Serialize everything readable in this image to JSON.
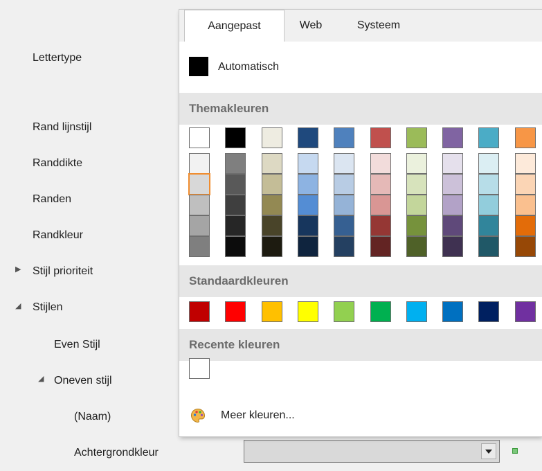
{
  "properties": {
    "font": "Lettertype",
    "border_style": "Rand lijnstijl",
    "border_width": "Randdikte",
    "borders": "Randen",
    "border_color": "Randkleur",
    "style_priority": "Stijl prioriteit",
    "styles": "Stijlen",
    "even_style": "Even Stijl",
    "odd_style": "Oneven stijl",
    "name": "(Naam)",
    "background_color": "Achtergrondkleur"
  },
  "icons": {
    "collapsed": "triangle-right-icon",
    "expanded": "triangle-down-icon",
    "palette": "palette-icon",
    "dropdown": "chevron-down-icon"
  },
  "color_picker": {
    "tabs": [
      {
        "label": "Aangepast",
        "active": true
      },
      {
        "label": "Web",
        "active": false
      },
      {
        "label": "Systeem",
        "active": false
      }
    ],
    "automatic_label": "Automatisch",
    "automatic_color": "#000000",
    "theme_header": "Themakleuren",
    "theme_top": [
      "#FFFFFF",
      "#000000",
      "#EEECE1",
      "#1F497D",
      "#4F81BD",
      "#C0504D",
      "#9BBB59",
      "#8064A2",
      "#4BACC6",
      "#F79646"
    ],
    "theme_shades": [
      [
        "#F2F2F2",
        "#D8D8D8",
        "#BFBFBF",
        "#A5A5A5",
        "#7F7F7F"
      ],
      [
        "#7F7F7F",
        "#595959",
        "#3F3F3F",
        "#262626",
        "#0C0C0C"
      ],
      [
        "#DDD9C3",
        "#C4BD97",
        "#938953",
        "#494429",
        "#1D1B10"
      ],
      [
        "#C6D9F0",
        "#8DB3E2",
        "#548DD4",
        "#17365D",
        "#0F243E"
      ],
      [
        "#DBE5F1",
        "#B8CCE4",
        "#95B3D7",
        "#366092",
        "#244061"
      ],
      [
        "#F2DCDB",
        "#E5B9B7",
        "#D99694",
        "#953734",
        "#632423"
      ],
      [
        "#EBF1DD",
        "#D7E3BC",
        "#C3D69B",
        "#76923C",
        "#4F6128"
      ],
      [
        "#E5E0EC",
        "#CCC1D9",
        "#B2A2C7",
        "#5F497A",
        "#3F3151"
      ],
      [
        "#DBEEF3",
        "#B7DDE8",
        "#92CDDC",
        "#31859B",
        "#205867"
      ],
      [
        "#FDEADA",
        "#FBD5B5",
        "#FAC08F",
        "#E36C09",
        "#974806"
      ]
    ],
    "selected_swatch": "#D8D8D8",
    "standard_header": "Standaardkleuren",
    "standard_colors": [
      "#C00000",
      "#FF0000",
      "#FFC000",
      "#FFFF00",
      "#92D050",
      "#00B050",
      "#00B0F0",
      "#0070C0",
      "#002060",
      "#7030A0"
    ],
    "recent_header": "Recente kleuren",
    "recent_colors": [
      "#FFFFFF"
    ],
    "more_colors_label": "Meer kleuren..."
  },
  "background_color_value": "#D9D9D9",
  "accent_color": "#F08C2E"
}
